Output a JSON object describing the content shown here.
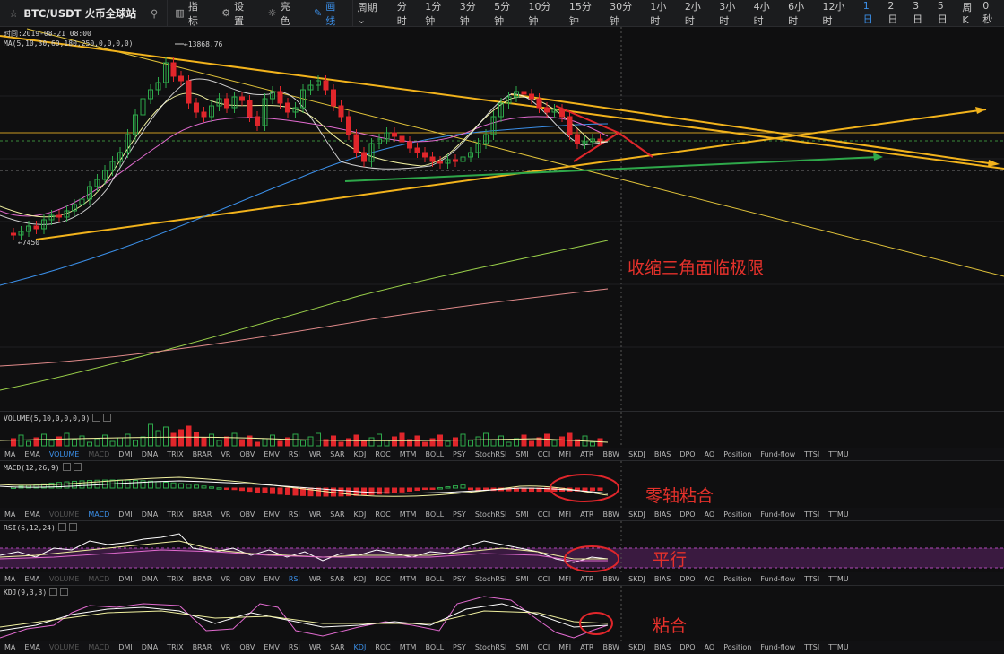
{
  "toolbar": {
    "symbol": "BTC/USDT 火币全球站",
    "buttons": [
      {
        "label": "指标",
        "icon": "chart-icon"
      },
      {
        "label": "设置",
        "icon": "gear-icon"
      },
      {
        "label": "亮色",
        "icon": "sun-icon"
      },
      {
        "label": "画线",
        "icon": "pen-icon"
      }
    ],
    "period_label": "周期",
    "periods": [
      "分时",
      "1分钟",
      "3分钟",
      "5分钟",
      "10分钟",
      "15分钟",
      "30分钟",
      "1小时",
      "2小时",
      "3小时",
      "4小时",
      "6小时",
      "12小时",
      "1日",
      "2日",
      "3日",
      "5日",
      "周K"
    ],
    "selected_period": "1日",
    "right_text": "0秒"
  },
  "main_chart": {
    "time_label": "时间:2019-08-21 08:00",
    "ma_label": "MA(5,10,30,60,180,250,0,0,0,0)",
    "high_marker": "13868.76",
    "low_marker": "7450",
    "annotation": "收缩三角面临极限"
  },
  "volume_pane": {
    "label": "VOLUME(5,10,0,0,0,0)"
  },
  "macd_pane": {
    "label": "MACD(12,26,9)",
    "annotation": "零轴粘合"
  },
  "rsi_pane": {
    "label": "RSI(6,12,24)",
    "annotation": "平行"
  },
  "kdj_pane": {
    "label": "KDJ(9,3,3)",
    "annotation": "粘合"
  },
  "indicator_tabs": [
    "MA",
    "EMA",
    "VOLUME",
    "MACD",
    "DMI",
    "DMA",
    "TRIX",
    "BRAR",
    "VR",
    "OBV",
    "EMV",
    "RSI",
    "WR",
    "SAR",
    "KDJ",
    "ROC",
    "MTM",
    "BOLL",
    "PSY",
    "StochRSI",
    "SMI",
    "CCI",
    "MFI",
    "ATR",
    "BBW",
    "SKDJ",
    "BIAS",
    "DPO",
    "AO",
    "Position",
    "Fund-flow",
    "TTSI",
    "TTMU"
  ],
  "tab_bars": [
    {
      "active": "VOLUME",
      "dim": [
        "MACD"
      ]
    },
    {
      "active": "MACD",
      "dim": [
        "VOLUME"
      ]
    },
    {
      "active": "RSI",
      "dim": [
        "VOLUME",
        "MACD"
      ]
    },
    {
      "active": "KDJ",
      "dim": [
        "VOLUME",
        "MACD"
      ]
    }
  ],
  "colors": {
    "up": "#2ea84a",
    "down": "#e0262b",
    "accent": "#3b8fe8",
    "trendline": "#f2b31c",
    "annotation": "#e4312b"
  }
}
